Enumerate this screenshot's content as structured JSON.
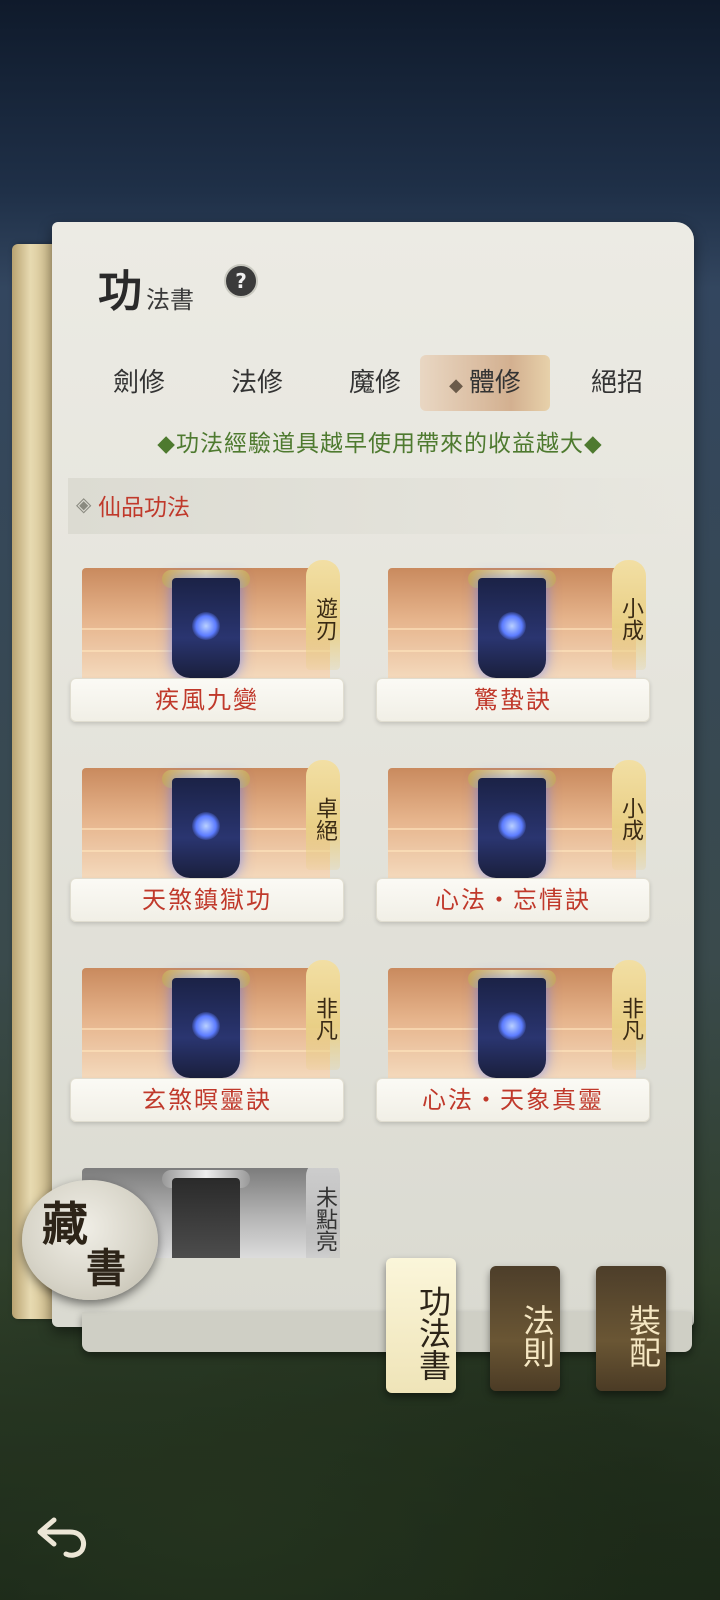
{
  "header": {
    "title_big": "功",
    "title_small": "法書",
    "help_icon": "question-mark-icon"
  },
  "tabs": [
    {
      "label": "劍修",
      "active": false
    },
    {
      "label": "法修",
      "active": false
    },
    {
      "label": "魔修",
      "active": false
    },
    {
      "label": "體修",
      "active": true
    },
    {
      "label": "絕招",
      "active": false
    }
  ],
  "notice": "◆功法經驗道具越早使用帶來的收益越大◆",
  "section": {
    "label": "仙品功法"
  },
  "cards": [
    {
      "name": "疾風九變",
      "rank": "遊刃"
    },
    {
      "name": "驚蛰訣",
      "rank": "小成"
    },
    {
      "name": "天煞鎮獄功",
      "rank": "卓絕"
    },
    {
      "name": "心法・忘情訣",
      "rank": "小成"
    },
    {
      "name": "玄煞暝靈訣",
      "rank": "非凡"
    },
    {
      "name": "心法・天象真靈",
      "rank": "非凡"
    },
    {
      "name": "",
      "rank": "未點亮"
    }
  ],
  "collection_button": {
    "line1": "藏",
    "line2": "書"
  },
  "bookmarks": [
    {
      "label": "功法書",
      "active": true
    },
    {
      "label": "法則",
      "active": false
    },
    {
      "label": "裝配",
      "active": false
    }
  ],
  "colors": {
    "accent_red": "#c0392b",
    "notice_green": "#4e7a2f"
  }
}
